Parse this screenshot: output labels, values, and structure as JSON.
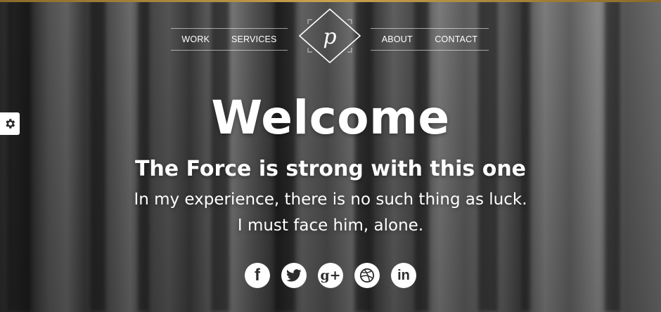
{
  "nav": {
    "left_items": [
      {
        "label": "WORK"
      },
      {
        "label": "SERVICES"
      }
    ],
    "right_items": [
      {
        "label": "ABOUT"
      },
      {
        "label": "CONTACT"
      }
    ],
    "logo_letter": "p"
  },
  "hero": {
    "title": "Welcome",
    "tagline": "The Force is strong with this one",
    "quote_line_1": "In my experience, there is no such thing as luck.",
    "quote_line_2": "I must face him, alone."
  },
  "social": [
    {
      "name": "facebook",
      "glyph": "f"
    },
    {
      "name": "twitter",
      "glyph": ""
    },
    {
      "name": "google-plus",
      "glyph": "g+"
    },
    {
      "name": "dribbble",
      "glyph": ""
    },
    {
      "name": "linkedin",
      "glyph": "in"
    }
  ],
  "colors": {
    "accent_gold": "#c9a24e",
    "text": "#ffffff",
    "icon_bg": "#ffffff"
  }
}
